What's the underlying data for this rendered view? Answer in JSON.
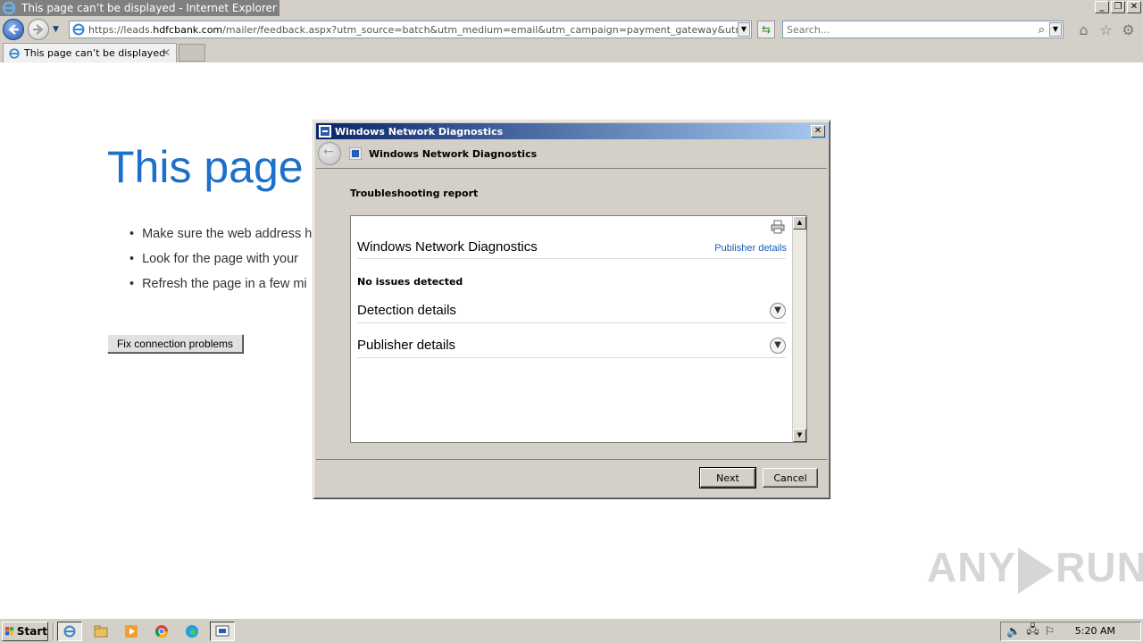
{
  "window": {
    "title": "This page can’t be displayed - Internet Explorer"
  },
  "address_bar": {
    "url_prefix": "https://leads.",
    "url_domain": "hdfcbank.com",
    "url_rest": "/mailer/feedback.aspx?utm_source=batch&utm_medium=email&utm_campaign=payment_gateway&utm_tag=unsubscript_"
  },
  "search": {
    "placeholder": "Search..."
  },
  "tab": {
    "label": "This page can’t be displayed"
  },
  "page": {
    "title": "This page c",
    "tips": [
      "Make sure the web address h",
      "Look for the page with your",
      "Refresh the page in a few mi"
    ],
    "fix_button": "Fix connection problems"
  },
  "dialog": {
    "title": "Windows Network Diagnostics",
    "header_title": "Windows Network Diagnostics",
    "report_heading": "Troubleshooting report",
    "report": {
      "title": "Windows Network Diagnostics",
      "publisher_link": "Publisher details",
      "status": "No issues detected",
      "sections": [
        "Detection details",
        "Publisher details"
      ]
    },
    "buttons": {
      "next": "Next",
      "cancel": "Cancel"
    }
  },
  "taskbar": {
    "start_label": "Start",
    "clock": "5:20 AM"
  },
  "watermark": {
    "text_left": "ANY",
    "text_right": "RUN"
  },
  "colors": {
    "page_title_blue": "#1e6fc9",
    "dialog_titlebar_start": "#0a246a",
    "dialog_titlebar_end": "#a6caf0",
    "link_blue": "#1a5fb4",
    "chrome_gray": "#d4d0c8"
  },
  "icons": {
    "ie": "ie-logo-icon",
    "back": "back-arrow-icon",
    "forward": "forward-arrow-icon",
    "home": "home-icon",
    "favorites": "star-icon",
    "tools": "gear-icon",
    "print": "printer-icon",
    "diagnostics": "network-diagnostics-icon"
  }
}
